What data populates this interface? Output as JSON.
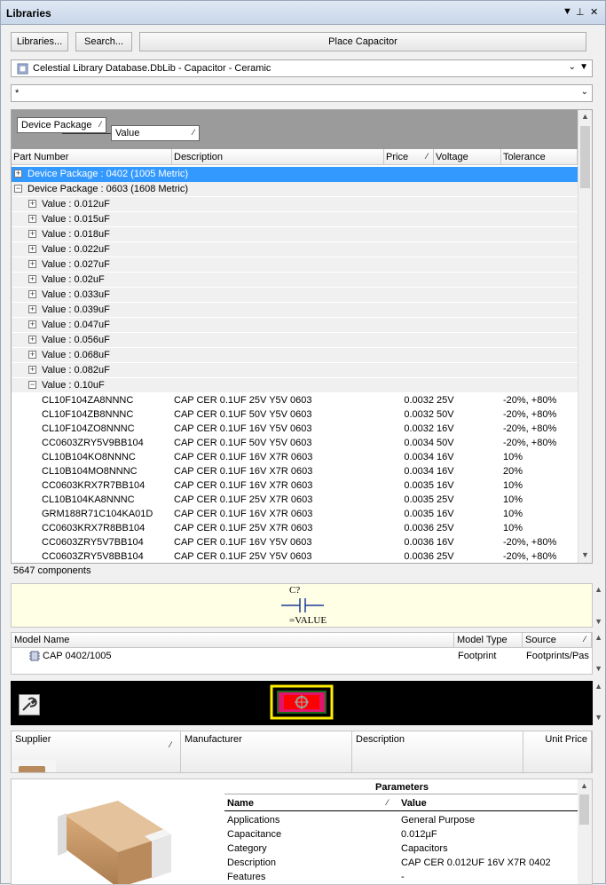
{
  "panel": {
    "title": "Libraries",
    "controls": [
      "▼",
      "📌",
      "✕"
    ]
  },
  "toolbar": {
    "libraries_btn": "Libraries...",
    "search_btn": "Search...",
    "place_btn": "Place Capacitor"
  },
  "library_combo": {
    "value": "Celestial Library Database.DbLib - Capacitor - Ceramic"
  },
  "filter_combo": {
    "value": "*"
  },
  "grouping": {
    "chip1": "Device Package",
    "chip2": "Value"
  },
  "columns": {
    "part_number": "Part Number",
    "description": "Description",
    "price": "Price",
    "voltage": "Voltage",
    "tolerance": "Tolerance"
  },
  "tree": {
    "pkg0402": "Device Package : 0402 (1005 Metric)",
    "pkg0603": "Device Package : 0603 (1608 Metric)",
    "values": [
      "Value : 0.012uF",
      "Value : 0.015uF",
      "Value : 0.018uF",
      "Value : 0.022uF",
      "Value : 0.027uF",
      "Value : 0.02uF",
      "Value : 0.033uF",
      "Value : 0.039uF",
      "Value : 0.047uF",
      "Value : 0.056uF",
      "Value : 0.068uF",
      "Value : 0.082uF",
      "Value : 0.10uF"
    ]
  },
  "parts": [
    {
      "pn": "CL10F104ZA8NNNC",
      "desc": "CAP CER 0.1UF 25V Y5V 0603",
      "price": "0.0032",
      "volt": "25V",
      "tol": "-20%, +80%"
    },
    {
      "pn": "CL10F104ZB8NNNC",
      "desc": "CAP CER 0.1UF 50V Y5V 0603",
      "price": "0.0032",
      "volt": "50V",
      "tol": "-20%, +80%"
    },
    {
      "pn": "CL10F104ZO8NNNC",
      "desc": "CAP CER 0.1UF 16V Y5V 0603",
      "price": "0.0032",
      "volt": "16V",
      "tol": "-20%, +80%"
    },
    {
      "pn": "CC0603ZRY5V9BB104",
      "desc": "CAP CER 0.1UF 50V Y5V 0603",
      "price": "0.0034",
      "volt": "50V",
      "tol": "-20%, +80%"
    },
    {
      "pn": "CL10B104KO8NNNC",
      "desc": "CAP CER 0.1UF 16V X7R 0603",
      "price": "0.0034",
      "volt": "16V",
      "tol": "10%"
    },
    {
      "pn": "CL10B104MO8NNNC",
      "desc": "CAP CER 0.1UF 16V X7R 0603",
      "price": "0.0034",
      "volt": "16V",
      "tol": "20%"
    },
    {
      "pn": "CC0603KRX7R7BB104",
      "desc": "CAP CER 0.1UF 16V X7R 0603",
      "price": "0.0035",
      "volt": "16V",
      "tol": "10%"
    },
    {
      "pn": "CL10B104KA8NNNC",
      "desc": "CAP CER 0.1UF 25V X7R 0603",
      "price": "0.0035",
      "volt": "25V",
      "tol": "10%"
    },
    {
      "pn": "GRM188R71C104KA01D",
      "desc": "CAP CER 0.1UF 16V X7R 0603",
      "price": "0.0035",
      "volt": "16V",
      "tol": "10%"
    },
    {
      "pn": "CC0603KRX7R8BB104",
      "desc": "CAP CER 0.1UF 25V X7R 0603",
      "price": "0.0036",
      "volt": "25V",
      "tol": "10%"
    },
    {
      "pn": "CC0603ZRY5V7BB104",
      "desc": "CAP CER 0.1UF 16V Y5V 0603",
      "price": "0.0036",
      "volt": "16V",
      "tol": "-20%, +80%"
    },
    {
      "pn": "CC0603ZRY5V8BB104",
      "desc": "CAP CER 0.1UF 25V Y5V 0603",
      "price": "0.0036",
      "volt": "25V",
      "tol": "-20%, +80%"
    }
  ],
  "status": {
    "count": "5647 components"
  },
  "symbol": {
    "designator": "C?",
    "value": "=VALUE"
  },
  "models": {
    "headers": {
      "name": "Model Name",
      "type": "Model Type",
      "source": "Source"
    },
    "row": {
      "name": "CAP 0402/1005",
      "type": "Footprint",
      "source": "Footprints/Pas"
    }
  },
  "supplier": {
    "headers": {
      "supplier": "Supplier",
      "manufacturer": "Manufacturer",
      "description": "Description",
      "unit_price": "Unit Price"
    }
  },
  "parameters": {
    "title": "Parameters",
    "headers": {
      "name": "Name",
      "value": "Value"
    },
    "rows": [
      {
        "name": "Applications",
        "value": "General Purpose"
      },
      {
        "name": "Capacitance",
        "value": "0.012µF"
      },
      {
        "name": "Category",
        "value": "Capacitors"
      },
      {
        "name": "Description",
        "value": "CAP CER 0.012UF 16V X7R 0402"
      },
      {
        "name": "Features",
        "value": "-"
      }
    ]
  },
  "colors": {
    "selection": "#3399ff",
    "title_bar": "#c9d7ea",
    "symbol_bg": "#ffffe6",
    "footprint_bg": "#000000"
  }
}
